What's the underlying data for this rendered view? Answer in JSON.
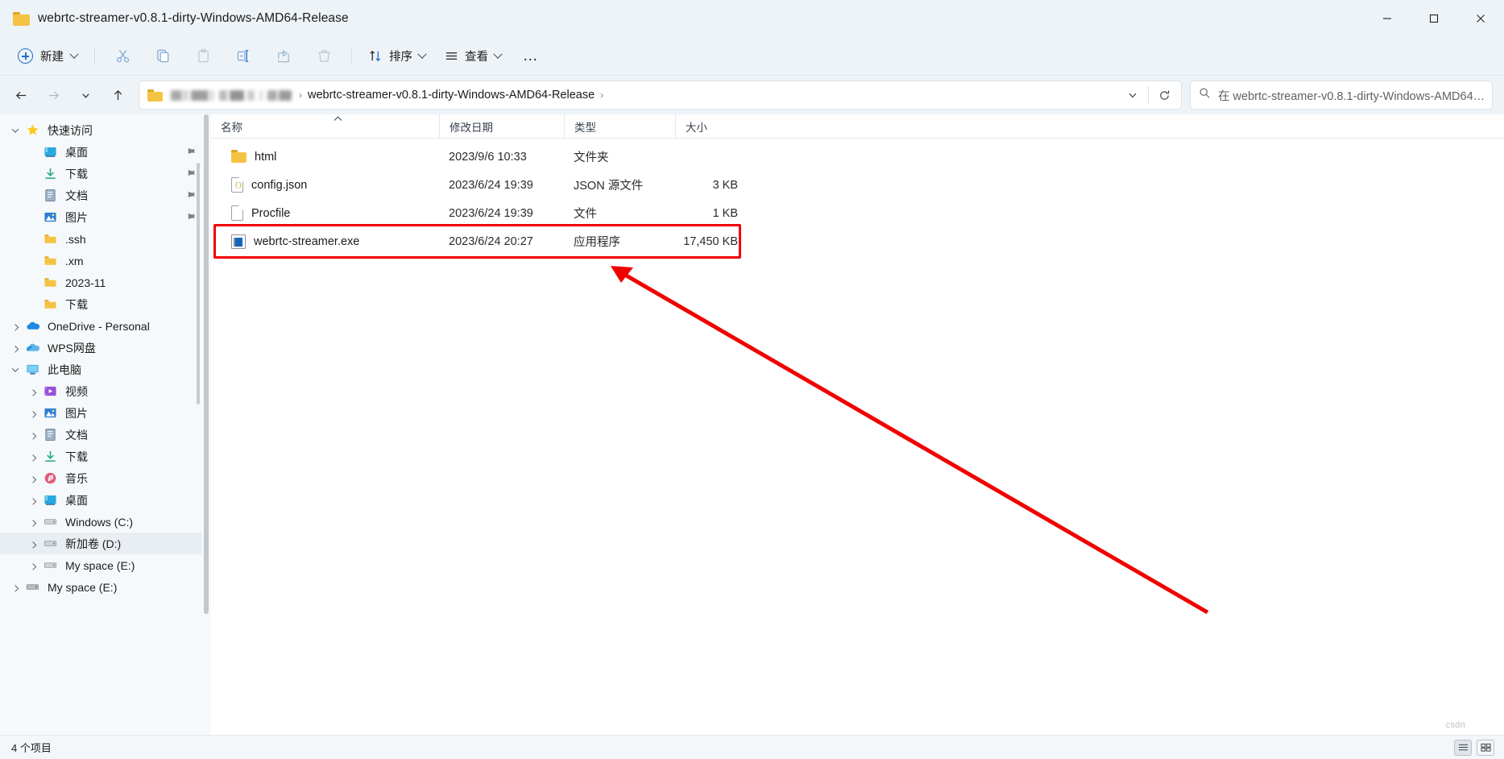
{
  "window": {
    "title": "webrtc-streamer-v0.8.1-dirty-Windows-AMD64-Release",
    "folder_icon": "folder-icon",
    "minimize_label": "最小化",
    "maximize_label": "最大化",
    "close_label": "关闭"
  },
  "toolbar": {
    "new_label": "新建",
    "cut_label": "剪切",
    "copy_label": "复制",
    "paste_label": "粘贴",
    "rename_label": "重命名",
    "share_label": "共享",
    "delete_label": "删除",
    "sort_label": "排序",
    "view_label": "查看",
    "more_label": "…"
  },
  "addressbar": {
    "back_label": "后退",
    "forward_label": "前进",
    "recent_label": "最近使用的位置",
    "up_label": "向上",
    "crumb_blurred": "███ ████ ██ ███",
    "crumb_current": "webrtc-streamer-v0.8.1-dirty-Windows-AMD64-Release",
    "separator": "›",
    "dropdown_label": "历史记录",
    "refresh_label": "刷新"
  },
  "search": {
    "placeholder": "在 webrtc-streamer-v0.8.1-dirty-Windows-AMD64…",
    "icon": "search-icon"
  },
  "sidebar": {
    "items": [
      {
        "label": "快速访问",
        "icon": "star-icon",
        "indent": 0,
        "expander": "down",
        "pinned": false,
        "selected": false
      },
      {
        "label": "桌面",
        "icon": "desktop-icon",
        "indent": 1,
        "expander": "none",
        "pinned": true,
        "selected": false
      },
      {
        "label": "下载",
        "icon": "download-icon",
        "indent": 1,
        "expander": "none",
        "pinned": true,
        "selected": false
      },
      {
        "label": "文档",
        "icon": "documents-icon",
        "indent": 1,
        "expander": "none",
        "pinned": true,
        "selected": false
      },
      {
        "label": "图片",
        "icon": "pictures-icon",
        "indent": 1,
        "expander": "none",
        "pinned": true,
        "selected": false
      },
      {
        "label": ".ssh",
        "icon": "folder-icon",
        "indent": 1,
        "expander": "none",
        "pinned": false,
        "selected": false
      },
      {
        "label": ".xm",
        "icon": "folder-icon",
        "indent": 1,
        "expander": "none",
        "pinned": false,
        "selected": false
      },
      {
        "label": "2023-11",
        "icon": "folder-icon",
        "indent": 1,
        "expander": "none",
        "pinned": false,
        "selected": false
      },
      {
        "label": "下载",
        "icon": "folder-icon",
        "indent": 1,
        "expander": "none",
        "pinned": false,
        "selected": false
      },
      {
        "label": "OneDrive - Personal",
        "icon": "onedrive-icon",
        "indent": 0,
        "expander": "right",
        "pinned": false,
        "selected": false
      },
      {
        "label": "WPS网盘",
        "icon": "wps-cloud-icon",
        "indent": 0,
        "expander": "right",
        "pinned": false,
        "selected": false
      },
      {
        "label": "此电脑",
        "icon": "this-pc-icon",
        "indent": 0,
        "expander": "down",
        "pinned": false,
        "selected": false
      },
      {
        "label": "视频",
        "icon": "videos-icon",
        "indent": 1,
        "expander": "right",
        "pinned": false,
        "selected": false
      },
      {
        "label": "图片",
        "icon": "pictures-icon",
        "indent": 1,
        "expander": "right",
        "pinned": false,
        "selected": false
      },
      {
        "label": "文档",
        "icon": "documents-icon",
        "indent": 1,
        "expander": "right",
        "pinned": false,
        "selected": false
      },
      {
        "label": "下载",
        "icon": "download-icon",
        "indent": 1,
        "expander": "right",
        "pinned": false,
        "selected": false
      },
      {
        "label": "音乐",
        "icon": "music-icon",
        "indent": 1,
        "expander": "right",
        "pinned": false,
        "selected": false
      },
      {
        "label": "桌面",
        "icon": "desktop-icon",
        "indent": 1,
        "expander": "right",
        "pinned": false,
        "selected": false
      },
      {
        "label": "Windows (C:)",
        "icon": "drive-icon",
        "indent": 1,
        "expander": "right",
        "pinned": false,
        "selected": false
      },
      {
        "label": "新加卷 (D:)",
        "icon": "drive-icon",
        "indent": 1,
        "expander": "right",
        "pinned": false,
        "selected": true
      },
      {
        "label": "My space (E:)",
        "icon": "drive-icon",
        "indent": 1,
        "expander": "right",
        "pinned": false,
        "selected": false
      },
      {
        "label": "My space (E:)",
        "icon": "network-drive-icon",
        "indent": 0,
        "expander": "right",
        "pinned": false,
        "selected": false
      }
    ]
  },
  "filelist": {
    "columns": [
      {
        "key": "name",
        "label": "名称",
        "sorted": true,
        "sort_dir": "asc"
      },
      {
        "key": "date",
        "label": "修改日期",
        "sorted": false,
        "sort_dir": ""
      },
      {
        "key": "type",
        "label": "类型",
        "sorted": false,
        "sort_dir": ""
      },
      {
        "key": "size",
        "label": "大小",
        "sorted": false,
        "sort_dir": ""
      }
    ],
    "rows": [
      {
        "name": "html",
        "date": "2023/9/6 10:33",
        "type": "文件夹",
        "size": "",
        "icon": "folder-icon",
        "highlighted": false
      },
      {
        "name": "config.json",
        "date": "2023/6/24 19:39",
        "type": "JSON 源文件",
        "size": "3 KB",
        "icon": "json-file-icon",
        "highlighted": false
      },
      {
        "name": "Procfile",
        "date": "2023/6/24 19:39",
        "type": "文件",
        "size": "1 KB",
        "icon": "generic-file-icon",
        "highlighted": false
      },
      {
        "name": "webrtc-streamer.exe",
        "date": "2023/6/24 20:27",
        "type": "应用程序",
        "size": "17,450 KB",
        "icon": "exe-file-icon",
        "highlighted": true
      }
    ]
  },
  "annotation": {
    "highlight_color": "#f10000",
    "arrow_color": "#f10000",
    "target_row": "webrtc-streamer.exe"
  },
  "statusbar": {
    "item_count_text": "4 个项目",
    "details_view_label": "详细信息视图",
    "large_icons_view_label": "大图标视图"
  },
  "watermark": {
    "text": "csdn"
  }
}
